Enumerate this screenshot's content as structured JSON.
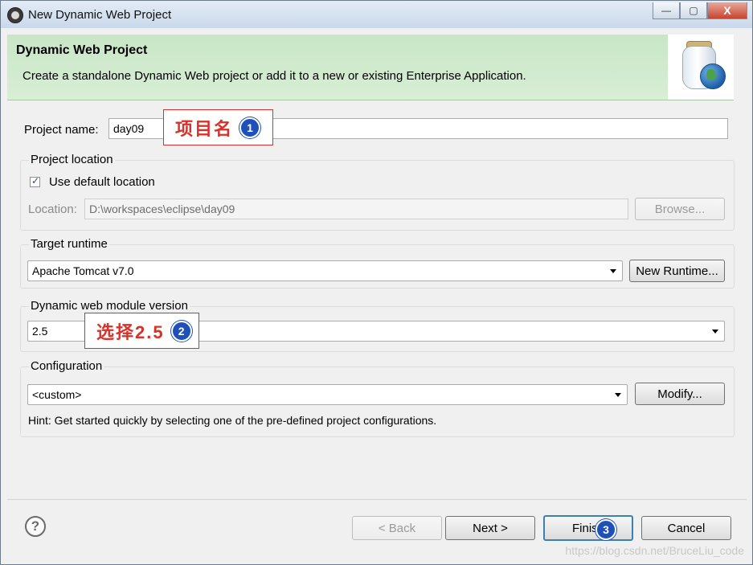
{
  "window": {
    "title": "New Dynamic Web Project",
    "controls": {
      "minimize": "—",
      "maximize": "▢",
      "close": "X"
    }
  },
  "banner": {
    "title": "Dynamic Web Project",
    "description": "Create a standalone Dynamic Web project or add it to a new or existing Enterprise Application.",
    "icon": "web-project-jar-globe-icon"
  },
  "project_name": {
    "label": "Project name:",
    "value": "day09"
  },
  "project_location": {
    "group_label": "Project location",
    "use_default_label": "Use default location",
    "use_default_checked": true,
    "location_label": "Location:",
    "location_value": "D:\\workspaces\\eclipse\\day09",
    "browse_label": "Browse..."
  },
  "target_runtime": {
    "group_label": "Target runtime",
    "selected": "Apache Tomcat v7.0",
    "new_runtime_label": "New Runtime..."
  },
  "module_version": {
    "group_label": "Dynamic web module version",
    "selected": "2.5"
  },
  "configuration": {
    "group_label": "Configuration",
    "selected": "<custom>",
    "modify_label": "Modify...",
    "hint": "Hint: Get started quickly by selecting one of the pre-defined project configurations."
  },
  "annotations": [
    {
      "text": "项目名",
      "number": "1"
    },
    {
      "text": "选择2.5",
      "number": "2"
    },
    {
      "number": "3"
    }
  ],
  "buttons": {
    "help": "?",
    "back": "< Back",
    "next": "Next >",
    "finish": "Finish",
    "cancel": "Cancel"
  },
  "watermark": "https://blog.csdn.net/BruceLiu_code",
  "colors": {
    "banner_bg": "#c8e6c6",
    "annotation_red": "#d9302a",
    "badge_blue": "#1f4fb8"
  }
}
